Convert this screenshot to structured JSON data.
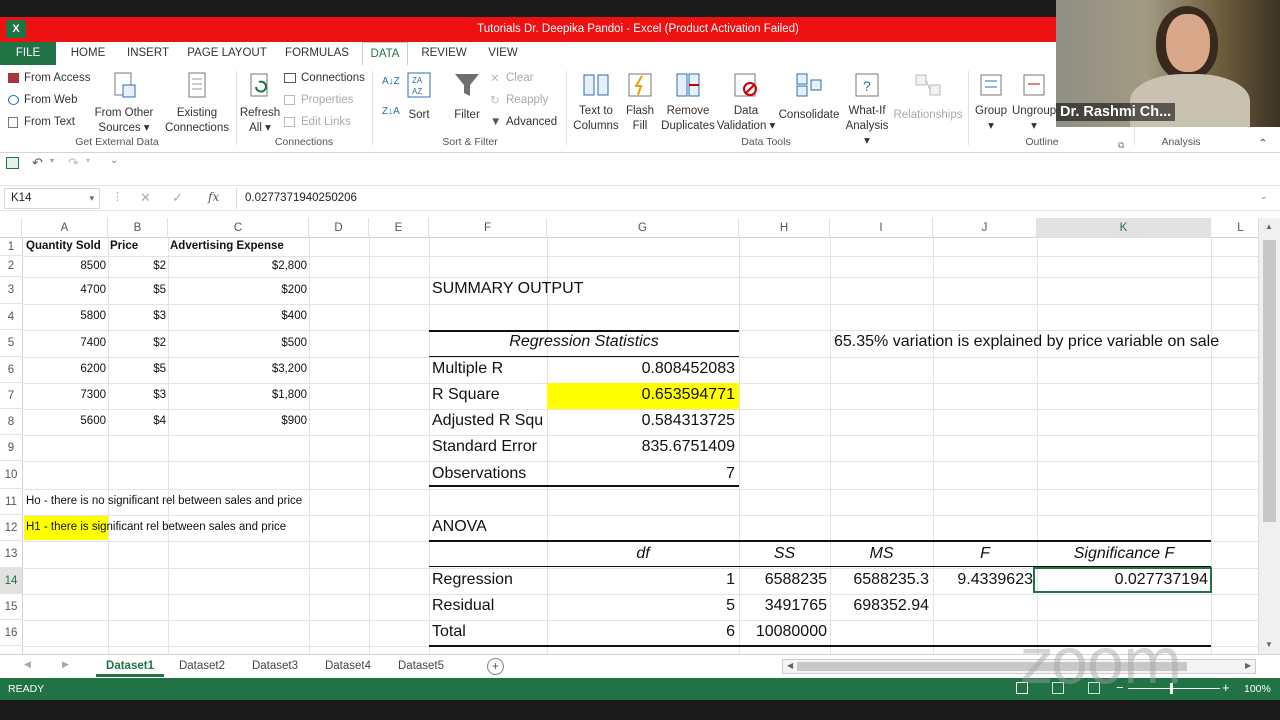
{
  "window": {
    "title": "Tutorials Dr. Deepika Pandoi - Excel (Product Activation Failed)"
  },
  "tabs": [
    "FILE",
    "HOME",
    "INSERT",
    "PAGE LAYOUT",
    "FORMULAS",
    "DATA",
    "REVIEW",
    "VIEW"
  ],
  "ribbon": {
    "get_external": {
      "from_access": "From Access",
      "from_web": "From Web",
      "from_text": "From Text",
      "from_other": "From Other",
      "sources": "Sources",
      "existing": "Existing",
      "connections": "Connections",
      "group": "Get External Data"
    },
    "connections": {
      "refresh": "Refresh",
      "all": "All",
      "connections": "Connections",
      "properties": "Properties",
      "edit_links": "Edit Links",
      "group": "Connections"
    },
    "sort_filter": {
      "sort": "Sort",
      "filter": "Filter",
      "clear": "Clear",
      "reapply": "Reapply",
      "advanced": "Advanced",
      "group": "Sort & Filter"
    },
    "data_tools": {
      "text_to": "Text to",
      "columns": "Columns",
      "flash": "Flash",
      "fill": "Fill",
      "remove": "Remove",
      "duplicates": "Duplicates",
      "data": "Data",
      "validation": "Validation",
      "consolidate": "Consolidate",
      "what_if": "What-If",
      "analysis": "Analysis",
      "relationships": "Relationships",
      "group": "Data Tools"
    },
    "outline": {
      "group_btn": "Group",
      "ungroup": "Ungroup",
      "group": "Outline"
    },
    "analysis": {
      "group": "Analysis"
    }
  },
  "formula_bar": {
    "name_box": "K14",
    "content": "0.0277371940250206"
  },
  "columns": [
    "A",
    "B",
    "C",
    "D",
    "E",
    "F",
    "G",
    "H",
    "I",
    "J",
    "K",
    "L"
  ],
  "rows": [
    "1",
    "2",
    "3",
    "4",
    "5",
    "6",
    "7",
    "8",
    "9",
    "10",
    "11",
    "12",
    "13",
    "14",
    "15",
    "16"
  ],
  "cells": {
    "a1": "Quantity Sold",
    "b1": "Price",
    "c1": "Advertising  Expense",
    "a2": "8500",
    "b2": "$2",
    "c2": "$2,800",
    "a3": "4700",
    "b3": "$5",
    "c3": "$200",
    "a4": "5800",
    "b4": "$3",
    "c4": "$400",
    "a5": "7400",
    "b5": "$2",
    "c5": "$500",
    "a6": "6200",
    "b6": "$5",
    "c6": "$3,200",
    "a7": "7300",
    "b7": "$3",
    "c7": "$1,800",
    "a8": "5600",
    "b8": "$4",
    "c8": "$900",
    "a11": "Ho - there is no significant rel between sales and price",
    "a12_hl": "H1 - there is ",
    "a12_rest": "significant rel between sales and price",
    "f3": "SUMMARY OUTPUT",
    "f5": "Regression Statistics",
    "f6": "Multiple R",
    "g6": "0.808452083",
    "f7": "R Square",
    "g7": "0.653594771",
    "f8": "Adjusted R Squ",
    "g8": "0.584313725",
    "f9": "Standard Error",
    "g9": "835.6751409",
    "f10": "Observations",
    "g10": "7",
    "i5": "65.35% variation is explained by price variable on sale",
    "f12": "ANOVA",
    "g13": "df",
    "h13": "SS",
    "i13": "MS",
    "j13": "F",
    "k13": "Significance F",
    "f14": "Regression",
    "g14": "1",
    "h14": "6588235",
    "i14": "6588235.3",
    "j14": "9.4339623",
    "k14": "0.027737194",
    "f15": "Residual",
    "g15": "5",
    "h15": "3491765",
    "i15": "698352.94",
    "f16": "Total",
    "g16": "6",
    "h16": "10080000"
  },
  "sheets": [
    "Dataset1",
    "Dataset2",
    "Dataset3",
    "Dataset4",
    "Dataset5"
  ],
  "status": {
    "ready": "READY",
    "zoom": "100%"
  },
  "webcam": {
    "name": "Dr. Rashmi Ch..."
  },
  "watermark": "zoom",
  "colors": {
    "excel_green": "#217346",
    "title_red": "#ee1111",
    "highlight": "#ffff00"
  }
}
